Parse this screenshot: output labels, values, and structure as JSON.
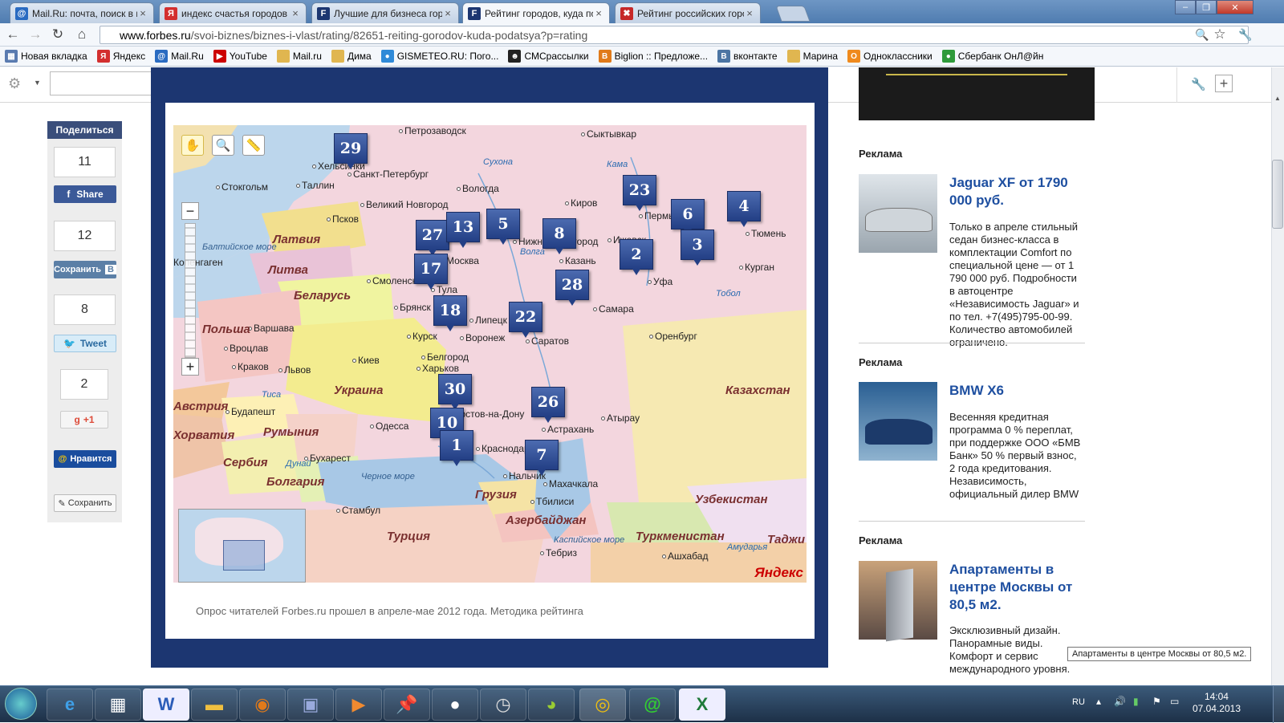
{
  "tabs": [
    {
      "title": "Mail.Ru: почта, поиск в и",
      "icon": "mailru-icon",
      "color": "#2a6bc1",
      "glyph": "@"
    },
    {
      "title": "индекс счастья городов р",
      "icon": "yandex-icon",
      "color": "#d32f2f",
      "glyph": "Я"
    },
    {
      "title": "Лучшие для бизнеса гор",
      "icon": "forbes-icon",
      "color": "#1c3671",
      "glyph": "F"
    },
    {
      "title": "Рейтинг городов, куда по",
      "icon": "forbes-icon",
      "color": "#1c3671",
      "glyph": "F",
      "active": true
    },
    {
      "title": "Рейтинг российских горо",
      "icon": "x-icon",
      "color": "#c62828",
      "glyph": "✖"
    }
  ],
  "address": {
    "host": "www.forbes.ru",
    "path": "/svoi-biznes/biznes-i-vlast/rating/82651-reiting-gorodov-kuda-podatsya?p=rating"
  },
  "bookmarks": [
    {
      "label": "Новая вкладка",
      "icon": "grid-icon",
      "color": "#5a7bb0",
      "glyph": "▦"
    },
    {
      "label": "Яндекс",
      "icon": "yandex-icon",
      "color": "#d32f2f",
      "glyph": "Я"
    },
    {
      "label": "Mail.Ru",
      "icon": "mailru-icon",
      "color": "#2a6bc1",
      "glyph": "@"
    },
    {
      "label": "YouTube",
      "icon": "youtube-icon",
      "color": "#cc0000",
      "glyph": "▶"
    },
    {
      "label": "Mail.ru",
      "icon": "folder-icon",
      "color": "#e0b650",
      "glyph": ""
    },
    {
      "label": "Дима",
      "icon": "folder-icon",
      "color": "#e0b650",
      "glyph": ""
    },
    {
      "label": "GISMETEO.RU: Пого...",
      "icon": "drop-icon",
      "color": "#2f8ad8",
      "glyph": "●"
    },
    {
      "label": "СМСрассылки",
      "icon": "sms-icon",
      "color": "#222222",
      "glyph": "☻"
    },
    {
      "label": "Biglion :: Предложе...",
      "icon": "biglion-icon",
      "color": "#e07a1a",
      "glyph": "B"
    },
    {
      "label": "вконтакте",
      "icon": "vk-icon",
      "color": "#4c75a3",
      "glyph": "B"
    },
    {
      "label": "Марина",
      "icon": "folder-icon",
      "color": "#e0b650",
      "glyph": ""
    },
    {
      "label": "Одноклассники",
      "icon": "odnoklassniki-icon",
      "color": "#ef8a1d",
      "glyph": "О"
    },
    {
      "label": "Сбербанк ОнЛ@йн",
      "icon": "sberbank-icon",
      "color": "#2e9a3a",
      "glyph": "●"
    }
  ],
  "share": {
    "title": "Поделиться",
    "facebook": {
      "count": "11",
      "label": "Share"
    },
    "vk": {
      "count": "12",
      "label": "Сохранить"
    },
    "twitter": {
      "count": "8",
      "label": "Tweet"
    },
    "gplus": {
      "count": "2",
      "label": "+1"
    },
    "mailru": {
      "label": "Нравится"
    },
    "save": {
      "label": "Сохранить"
    }
  },
  "map": {
    "cities": [
      "Петрозаводск",
      "Сыктывкар",
      "Хельсинки",
      "Санкт-Петербург",
      "Стокгольм",
      "Таллин",
      "Вологда",
      "Великий Новгород",
      "Киров",
      "Псков",
      "Пермь",
      "Тюмень",
      "Нижний Новгород",
      "Ижевск",
      "Москва",
      "Казань",
      "Уфа",
      "Курган",
      "Смоленск",
      "Тула",
      "Самара",
      "Брянск",
      "Липецк",
      "Воронеж",
      "Курск",
      "Саратов",
      "Оренбург",
      "Варшава",
      "Вроцлав",
      "Белгород",
      "Киев",
      "Харьков",
      "Краков",
      "Львов",
      "Будапешт",
      "Одесса",
      "Ростов-на-Дону",
      "Атырау",
      "Астрахань",
      "Краснодар",
      "Бухарест",
      "Махачкала",
      "Нальчик",
      "Тбилиси",
      "Стамбул",
      "Ашхабад",
      "Тебриз",
      "Копенгаген"
    ],
    "regions": [
      "Латвия",
      "Литва",
      "Беларусь",
      "Польша",
      "Украина",
      "Австрия",
      "Румыния",
      "Хорватия",
      "Сербия",
      "Болгария",
      "Грузия",
      "Азербайджан",
      "Турция",
      "Туркменистан",
      "Казахстан",
      "Узбекистан",
      "Таджи"
    ],
    "seas": [
      "Балтийское море",
      "Черное море",
      "Каспийское море"
    ],
    "rivers": [
      "Сухона",
      "Кама",
      "Волга",
      "Тобол",
      "Тиса",
      "Дунай",
      "Амударья"
    ],
    "markers": [
      "29",
      "23",
      "4",
      "6",
      "27",
      "13",
      "5",
      "8",
      "2",
      "3",
      "17",
      "28",
      "18",
      "22",
      "30",
      "26",
      "10",
      "1",
      "7"
    ],
    "brand": "Яндекс"
  },
  "caption": "Опрос читателей Forbes.ru прошел в апреле-мае 2012 года. Методика рейтинга",
  "ads": [
    {
      "heading": "Реклама",
      "title": "Jaguar XF от 1790 000 руб.",
      "body": "Только в апреле стильный седан бизнес-класса в комплектации Comfort по специальной цене — от 1 790 000 руб. Подробности в автоцентре «Независимость Jaguar» и по тел. +7(495)795-00-99. Количество автомобилей ограничено."
    },
    {
      "heading": "Реклама",
      "title": "BMW X6",
      "body": "Весенняя кредитная программа 0 % переплат, при поддержке ООО «БМВ Банк» 50 % первый взнос, 2 года кредитования. Независимость, официальный дилер BMW"
    },
    {
      "heading": "Реклама",
      "title": "Апартаменты в центре Москвы от 80,5 м2.",
      "body": "Эксклюзивный дизайн. Панорамные виды. Комфорт и сервис международного уровня."
    }
  ],
  "tooltip": "Апартаменты в центре Москвы от 80,5 м2.",
  "taskbar": {
    "lang": "RU",
    "time": "14:04",
    "date": "07.04.2013"
  }
}
